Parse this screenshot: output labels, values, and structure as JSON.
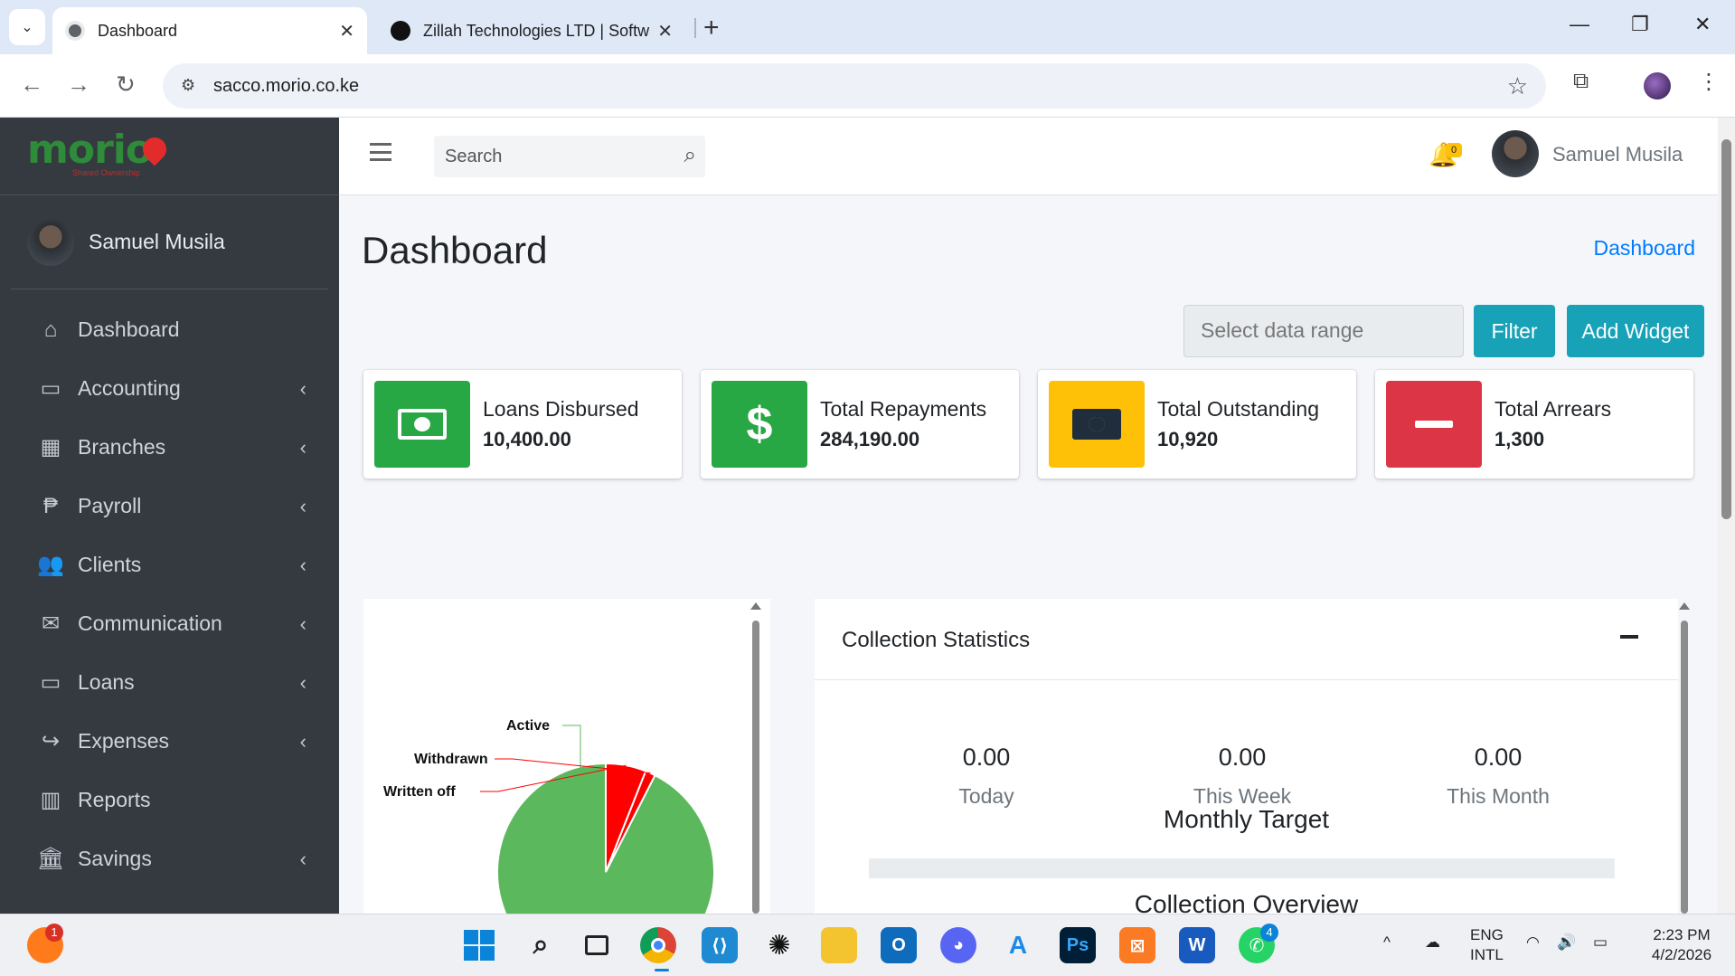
{
  "browser": {
    "tabs": [
      {
        "title": "Dashboard",
        "active": true
      },
      {
        "title": "Zillah Technologies LTD | Softwa",
        "active": false
      }
    ],
    "url": "sacco.morio.co.ke"
  },
  "sidebar": {
    "brand": "morio",
    "brand_sub": "Shared Ownership",
    "user": "Samuel Musila",
    "items": [
      {
        "label": "Dashboard",
        "icon": "home-icon",
        "has_submenu": false
      },
      {
        "label": "Accounting",
        "icon": "money-bill-icon",
        "has_submenu": true
      },
      {
        "label": "Branches",
        "icon": "building-icon",
        "has_submenu": true
      },
      {
        "label": "Payroll",
        "icon": "paypal-icon",
        "has_submenu": true
      },
      {
        "label": "Clients",
        "icon": "users-icon",
        "has_submenu": true
      },
      {
        "label": "Communication",
        "icon": "envelope-icon",
        "has_submenu": true
      },
      {
        "label": "Loans",
        "icon": "money-bill-icon",
        "has_submenu": true
      },
      {
        "label": "Expenses",
        "icon": "share-icon",
        "has_submenu": true
      },
      {
        "label": "Reports",
        "icon": "chart-bar-icon",
        "has_submenu": false
      },
      {
        "label": "Savings",
        "icon": "bank-icon",
        "has_submenu": true
      }
    ]
  },
  "topnav": {
    "search_placeholder": "Search",
    "notification_count": "0",
    "user": "Samuel Musila"
  },
  "page": {
    "title": "Dashboard",
    "breadcrumb": "Dashboard",
    "date_range_placeholder": "Select data range",
    "filter_label": "Filter",
    "add_widget_label": "Add Widget"
  },
  "info_boxes": [
    {
      "label": "Loans Disbursed",
      "value": "10,400.00",
      "color": "#28a745",
      "icon": "money-bill-icon"
    },
    {
      "label": "Total Repayments",
      "value": "284,190.00",
      "color": "#28a745",
      "icon": "dollar-icon"
    },
    {
      "label": "Total Outstanding",
      "value": "10,920",
      "color": "#ffc107",
      "icon": "money-bill-icon"
    },
    {
      "label": "Total Arrears",
      "value": "1,300",
      "color": "#dc3545",
      "icon": "minus-icon"
    }
  ],
  "chart_data": {
    "type": "pie",
    "categories": [
      "Active",
      "Withdrawn",
      "Written off"
    ],
    "values": [
      92.5,
      1.5,
      6
    ],
    "colors": [
      "#5cb85c",
      "#ff0000",
      "#ff0000"
    ]
  },
  "collection": {
    "title": "Collection Statistics",
    "stats": [
      {
        "value": "0.00",
        "label": "Today"
      },
      {
        "value": "0.00",
        "label": "This Week"
      },
      {
        "value": "0.00",
        "label": "This Month"
      }
    ],
    "monthly_target_label": "Monthly Target",
    "monthly_target_progress": 0,
    "overview_label": "Collection Overview"
  },
  "taskbar": {
    "notification_badge": "1",
    "whatsapp_badge": "4",
    "lang": "ENG",
    "layout": "INTL",
    "time": "2:23 PM",
    "date": "4/2/2026"
  }
}
